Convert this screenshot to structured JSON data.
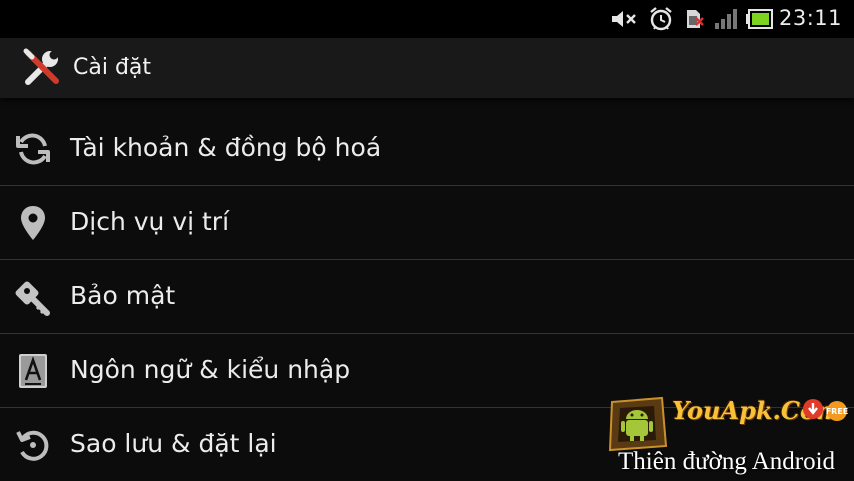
{
  "status_bar": {
    "time": "23:11",
    "icons": [
      "volume-muted-icon",
      "alarm-clock-icon",
      "no-sim-icon",
      "signal-icon",
      "battery-icon"
    ]
  },
  "action_bar": {
    "icon": "settings-tools-icon",
    "title": "Cài đặt"
  },
  "settings": {
    "items": [
      {
        "label": "Tài khoản & đồng bộ hoá",
        "icon": "sync-icon"
      },
      {
        "label": "Dịch vụ vị trí",
        "icon": "location-pin-icon"
      },
      {
        "label": "Bảo mật",
        "icon": "key-icon"
      },
      {
        "label": "Ngôn ngữ & kiểu nhập",
        "icon": "language-icon"
      },
      {
        "label": "Sao lưu & đặt lại",
        "icon": "backup-restore-icon"
      }
    ]
  },
  "watermark": {
    "brand": "YouApk.Com",
    "tagline": "Thiên đường Android"
  }
}
